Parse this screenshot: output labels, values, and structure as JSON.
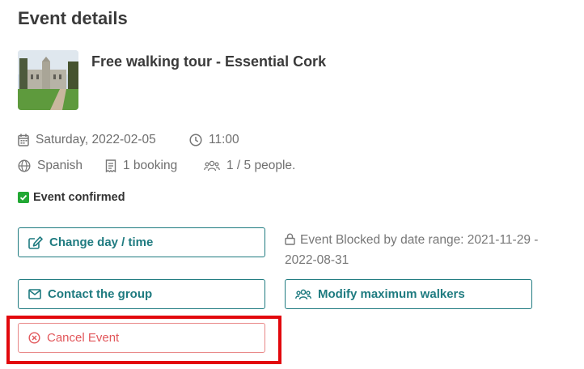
{
  "header": {
    "title": "Event details"
  },
  "event": {
    "name": "Free walking tour - Essential Cork",
    "date": "Saturday, 2022-02-05",
    "time": "11:00",
    "language": "Spanish",
    "bookings": "1 booking",
    "people": "1 / 5 people."
  },
  "status": {
    "confirmed_label": "Event confirmed",
    "confirmed_color": "#22a834"
  },
  "actions": {
    "change_day_time": "Change day / time",
    "contact_group": "Contact the group",
    "modify_walkers": "Modify maximum walkers",
    "cancel_event": "Cancel Event"
  },
  "notice": {
    "blocked_text": "Event Blocked by date range: 2021-11-29 - 2022-08-31"
  },
  "colors": {
    "accent": "#1f7b80",
    "danger": "#e2575b",
    "highlight": "#e2080d"
  }
}
